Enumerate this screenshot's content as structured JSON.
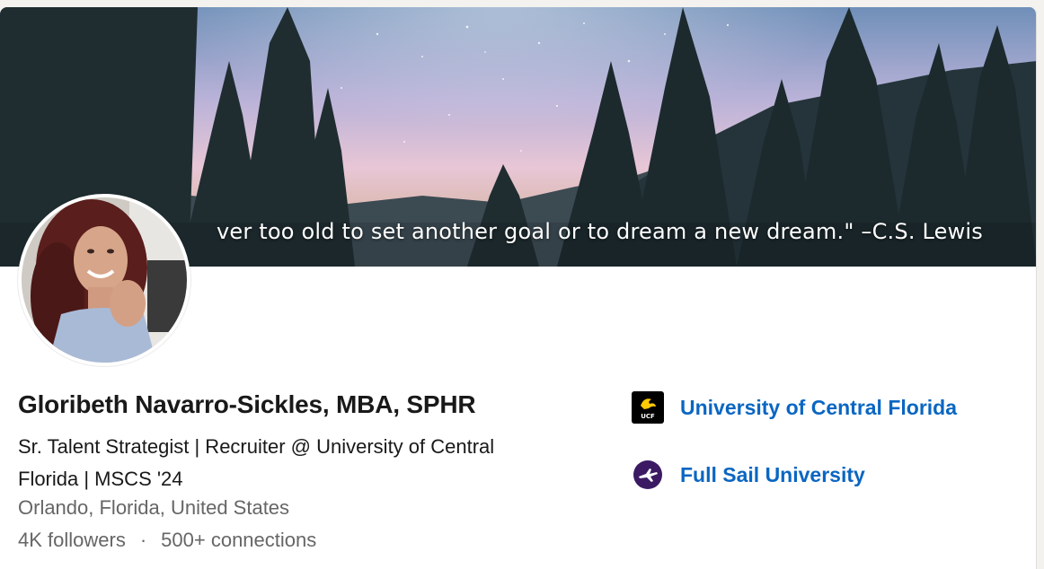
{
  "banner": {
    "quote": "ver too old to set another goal or to dream a new dream.\" –C.S. Lewis"
  },
  "profile": {
    "name": "Gloribeth Navarro-Sickles, MBA, SPHR",
    "headline": "Sr. Talent Strategist | Recruiter @ University of Central Florida | MSCS '24",
    "location": "Orlando, Florida, United States",
    "followers": "4K followers",
    "separator": "·",
    "connections": "500+ connections"
  },
  "education": [
    {
      "name": "University of Central Florida",
      "logo_text": "UCF",
      "logo_icon": "ucf-pegasus-icon"
    },
    {
      "name": "Full Sail University",
      "logo_icon": "full-sail-icon"
    }
  ],
  "colors": {
    "link": "#0a66c2",
    "secondary_text": "#666666",
    "ucf_gold": "#ffc904",
    "full_sail_purple": "#3b1a63"
  }
}
